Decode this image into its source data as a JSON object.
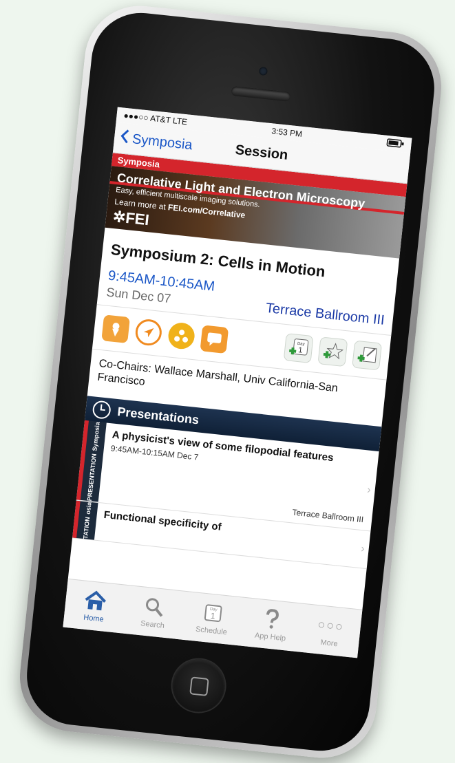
{
  "status": {
    "carrier": "●●●○○ AT&T LTE",
    "time": "3:53 PM"
  },
  "nav": {
    "back_label": "Symposia",
    "title": "Session"
  },
  "section_tag": "Symposia",
  "banner": {
    "headline": "Correlative Light and Electron Microscopy",
    "subline": "Easy, efficient multiscale imaging solutions.",
    "learn_more_prefix": "Learn more at ",
    "learn_more_link": "FEI.com/Correlative",
    "logo": "✲FEI"
  },
  "session": {
    "title": "Symposium 2: Cells in Motion",
    "time": "9:45AM-10:45AM",
    "date": "Sun Dec 07",
    "room": "Terrace Ballroom III",
    "cochairs": "Co-Chairs: Wallace Marshall, Univ California-San Francisco"
  },
  "actions": {
    "map_icon": "map-pin-icon",
    "navigate_icon": "navigate-icon",
    "share_icon": "share-icon",
    "chat_icon": "chat-icon",
    "add_schedule_icon": "add-to-schedule-icon",
    "add_favorite_icon": "add-favorite-icon",
    "add_note_icon": "add-note-icon",
    "day_label": "Day",
    "day_number": "1"
  },
  "presentations": {
    "header": "Presentations",
    "items": [
      {
        "tag_top": "PRESENTATION",
        "tag_bottom": "Symposia",
        "title": "A physicist's view of some filopodial features",
        "time": "9:45AM-10:15AM  Dec 7",
        "room": "Terrace Ballroom III"
      },
      {
        "tag_top": "TATION",
        "tag_bottom": "osia",
        "title": "Functional specificity of",
        "time": "",
        "room": ""
      }
    ]
  },
  "tabs": [
    {
      "label": "Home",
      "icon": "home-icon"
    },
    {
      "label": "Search",
      "icon": "search-icon"
    },
    {
      "label": "Schedule",
      "icon": "calendar-icon"
    },
    {
      "label": "App Help",
      "icon": "help-icon"
    },
    {
      "label": "More",
      "icon": "more-icon"
    }
  ],
  "colors": {
    "accent_red": "#d4252c",
    "link_blue": "#1b57c7",
    "navy": "#1e3350"
  }
}
